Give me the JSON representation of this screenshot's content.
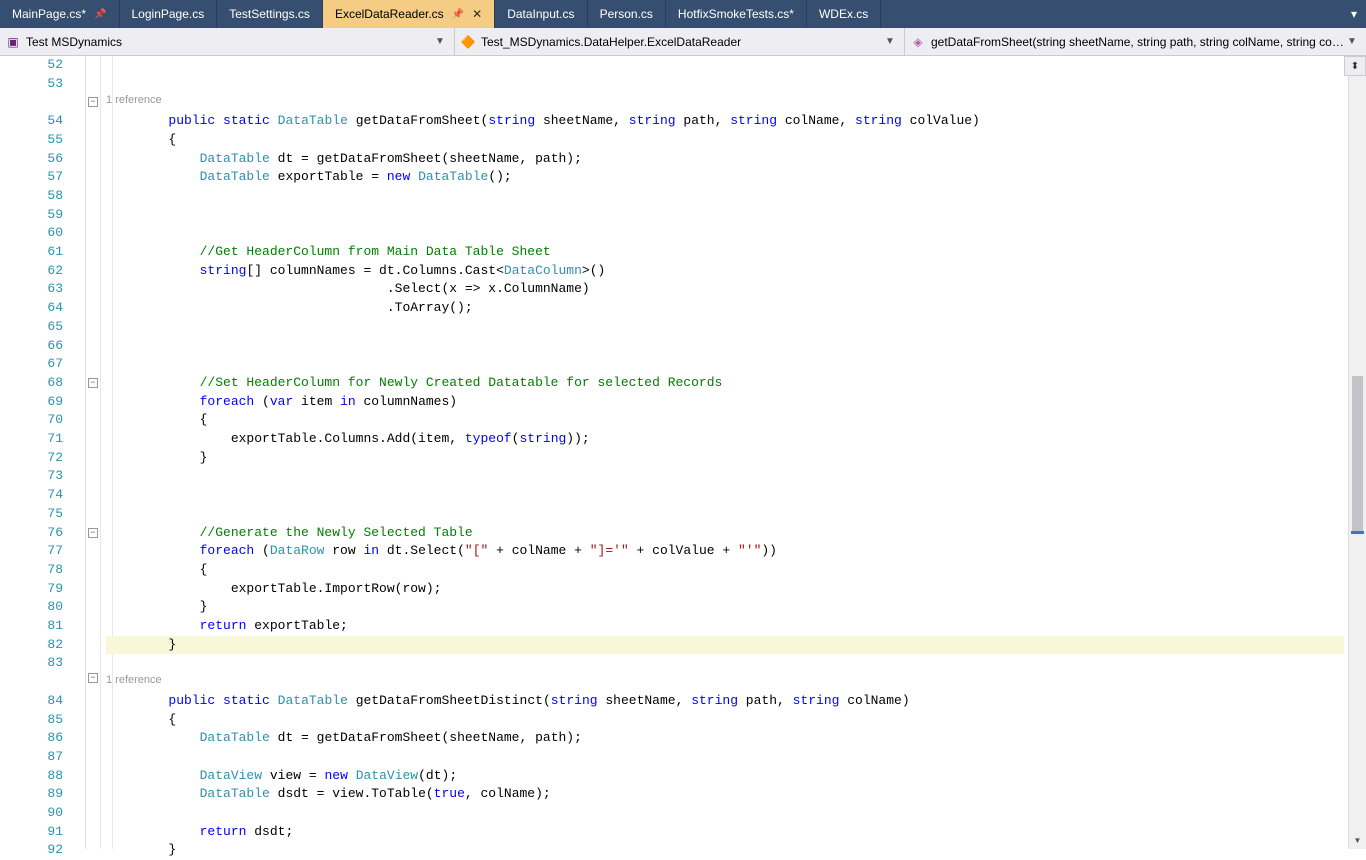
{
  "tabs": [
    {
      "label": "MainPage.cs*",
      "pinned": true,
      "active": false
    },
    {
      "label": "LoginPage.cs",
      "pinned": false,
      "active": false
    },
    {
      "label": "TestSettings.cs",
      "pinned": false,
      "active": false
    },
    {
      "label": "ExcelDataReader.cs",
      "pinned": true,
      "active": true,
      "closable": true
    },
    {
      "label": "DataInput.cs",
      "pinned": false,
      "active": false
    },
    {
      "label": "Person.cs",
      "pinned": false,
      "active": false
    },
    {
      "label": "HotfixSmokeTests.cs*",
      "pinned": false,
      "active": false
    },
    {
      "label": "WDEx.cs",
      "pinned": false,
      "active": false
    }
  ],
  "nav": {
    "project": "Test MSDynamics",
    "class": "Test_MSDynamics.DataHelper.ExcelDataReader",
    "member": "getDataFromSheet(string sheetName, string path, string colName, string colValue)"
  },
  "startLine": 52,
  "refText": "1 reference",
  "code": {
    "l54": {
      "pre": "        ",
      "sig1": "public",
      "sig2": "static",
      "type": "DataTable",
      "name": "getDataFromSheet",
      "args_open": "(",
      "p1t": "string",
      "p1n": " sheetName, ",
      "p2t": "string",
      "p2n": " path, ",
      "p3t": "string",
      "p3n": " colName, ",
      "p4t": "string",
      "p4n": " colValue)",
      "close": ""
    },
    "l55": "        {",
    "l56": {
      "pre": "            ",
      "t": "DataTable",
      "rest": " dt = getDataFromSheet(sheetName, path);"
    },
    "l57": {
      "pre": "            ",
      "t": "DataTable",
      "rest1": " exportTable = ",
      "kw": "new",
      "rest2": " ",
      "t2": "DataTable",
      "rest3": "();"
    },
    "l61": "            //Get HeaderColumn from Main Data Table Sheet",
    "l62": {
      "pre": "            ",
      "kw": "string",
      "rest1": "[] columnNames = dt.Columns.Cast<",
      "t": "DataColumn",
      "rest2": ">()"
    },
    "l63": "                                    .Select(x => x.ColumnName)",
    "l64": "                                    .ToArray();",
    "l68": "            //Set HeaderColumn for Newly Created Datatable for selected Records",
    "l69": {
      "pre": "            ",
      "kw1": "foreach",
      "rest1": " (",
      "kw2": "var",
      "rest2": " item ",
      "kw3": "in",
      "rest3": " columnNames)"
    },
    "l70": "            {",
    "l71": {
      "pre": "                exportTable.Columns.Add(item, ",
      "kw": "typeof",
      "rest1": "(",
      "kw2": "string",
      "rest2": "));"
    },
    "l72": "            }",
    "l76": "            //Generate the Newly Selected Table",
    "l77": {
      "pre": "            ",
      "kw1": "foreach",
      "rest1": " (",
      "t": "DataRow",
      "rest2": " row ",
      "kw2": "in",
      "rest3": " dt.Select(",
      "s1": "\"[\"",
      "rest4": " + colName + ",
      "s2": "\"]='\"",
      "rest5": " + colValue + ",
      "s3": "\"'\"",
      "rest6": "))"
    },
    "l78": "            {",
    "l79": "                exportTable.ImportRow(row);",
    "l80": "            }",
    "l81": {
      "pre": "            ",
      "kw": "return",
      "rest": " exportTable;"
    },
    "l82": "        }",
    "l84": {
      "pre": "        ",
      "sig1": "public",
      "sig2": "static",
      "type": "DataTable",
      "name": "getDataFromSheetDistinct",
      "p1t": "string",
      "p1n": " sheetName, ",
      "p2t": "string",
      "p2n": " path, ",
      "p3t": "string",
      "p3n": " colName)"
    },
    "l85": "        {",
    "l86": {
      "pre": "            ",
      "t": "DataTable",
      "rest": " dt = getDataFromSheet(sheetName, path);"
    },
    "l88": {
      "pre": "            ",
      "t": "DataView",
      "rest1": " view = ",
      "kw": "new",
      "rest2": " ",
      "t2": "DataView",
      "rest3": "(dt);"
    },
    "l89": {
      "pre": "            ",
      "t": "DataTable",
      "rest1": " dsdt = view.ToTable(",
      "kw": "true",
      "rest2": ", colName);"
    },
    "l91": {
      "pre": "            ",
      "kw": "return",
      "rest": " dsdt;"
    },
    "l92": "        }"
  }
}
